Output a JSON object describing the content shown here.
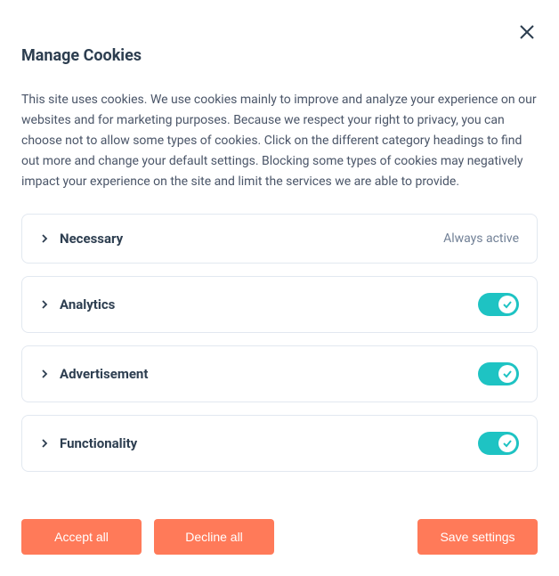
{
  "title": "Manage Cookies",
  "description": "This site uses cookies. We use cookies mainly to improve and analyze your experience on our websites and for marketing purposes. Because we respect your right to privacy, you can choose not to allow some types of cookies. Click on the different category headings to find out more and change your default settings. Blocking some types of cookies may negatively impact your experience on the site and limit the services we are able to provide.",
  "alwaysActiveLabel": "Always active",
  "categories": [
    {
      "name": "Necessary",
      "alwaysActive": true
    },
    {
      "name": "Analytics",
      "enabled": true
    },
    {
      "name": "Advertisement",
      "enabled": true
    },
    {
      "name": "Functionality",
      "enabled": true
    }
  ],
  "buttons": {
    "acceptAll": "Accept all",
    "declineAll": "Decline all",
    "saveSettings": "Save settings"
  }
}
